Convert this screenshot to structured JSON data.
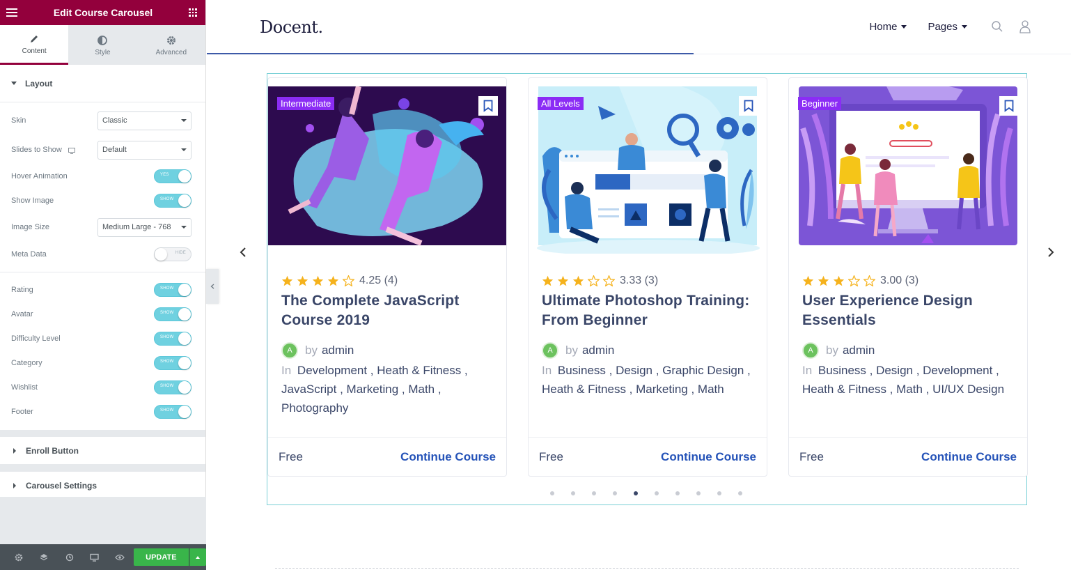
{
  "panel": {
    "title": "Edit Course Carousel",
    "tabs": [
      {
        "label": "Content"
      },
      {
        "label": "Style"
      },
      {
        "label": "Advanced"
      }
    ],
    "layout_section": "Layout",
    "controls": {
      "skin": {
        "label": "Skin",
        "value": "Classic"
      },
      "slides": {
        "label": "Slides to Show",
        "value": "Default"
      },
      "hover_animation": {
        "label": "Hover Animation",
        "state": "YES"
      },
      "show_image": {
        "label": "Show Image",
        "state": "SHOW"
      },
      "image_size": {
        "label": "Image Size",
        "value": "Medium Large - 768"
      },
      "meta_data": {
        "label": "Meta Data",
        "state": "HIDE"
      },
      "rating": {
        "label": "Rating",
        "state": "SHOW"
      },
      "avatar": {
        "label": "Avatar",
        "state": "SHOW"
      },
      "difficulty": {
        "label": "Difficulty Level",
        "state": "SHOW"
      },
      "category": {
        "label": "Category",
        "state": "SHOW"
      },
      "wishlist": {
        "label": "Wishlist",
        "state": "SHOW"
      },
      "footer": {
        "label": "Footer",
        "state": "SHOW"
      }
    },
    "enroll_section": "Enroll Button",
    "carousel_section": "Carousel Settings",
    "update_label": "UPDATE",
    "accent_color": "#93003c",
    "toggle_color": "#6fd1e0",
    "update_color": "#39b54a"
  },
  "site": {
    "logo": "Docent.",
    "nav": [
      {
        "label": "Home"
      },
      {
        "label": "Pages"
      }
    ]
  },
  "courses": [
    {
      "level": "Intermediate",
      "rating_text": "4.25 (4)",
      "stars": 4,
      "title": "The Complete JavaScript Course 2019",
      "by": "by",
      "author": "admin",
      "avatar_letter": "A",
      "in": "In",
      "categories": "Development ,  Heath & Fitness ,  JavaScript ,  Marketing ,  Math ,  Photography",
      "price": "Free",
      "cta": "Continue Course"
    },
    {
      "level": "All Levels",
      "rating_text": "3.33 (3)",
      "stars": 3,
      "title": "Ultimate Photoshop Training: From Beginner",
      "by": "by",
      "author": "admin",
      "avatar_letter": "A",
      "in": "In",
      "categories": "Business ,  Design ,  Graphic Design ,  Heath & Fitness ,  Marketing ,  Math",
      "price": "Free",
      "cta": "Continue Course"
    },
    {
      "level": "Beginner",
      "rating_text": "3.00 (3)",
      "stars": 3,
      "title": "User Experience Design Essentials",
      "by": "by",
      "author": "admin",
      "avatar_letter": "A",
      "in": "In",
      "categories": "Business ,  Design ,  Development ,  Heath & Fitness ,  Math ,  UI/UX Design",
      "price": "Free",
      "cta": "Continue Course"
    }
  ],
  "carousel": {
    "page_count": 10,
    "active_page": 5
  },
  "colors": {
    "star": "#f5b21c",
    "badge": "#8b2cf5",
    "link": "#2553b8",
    "title": "#3a4668"
  }
}
